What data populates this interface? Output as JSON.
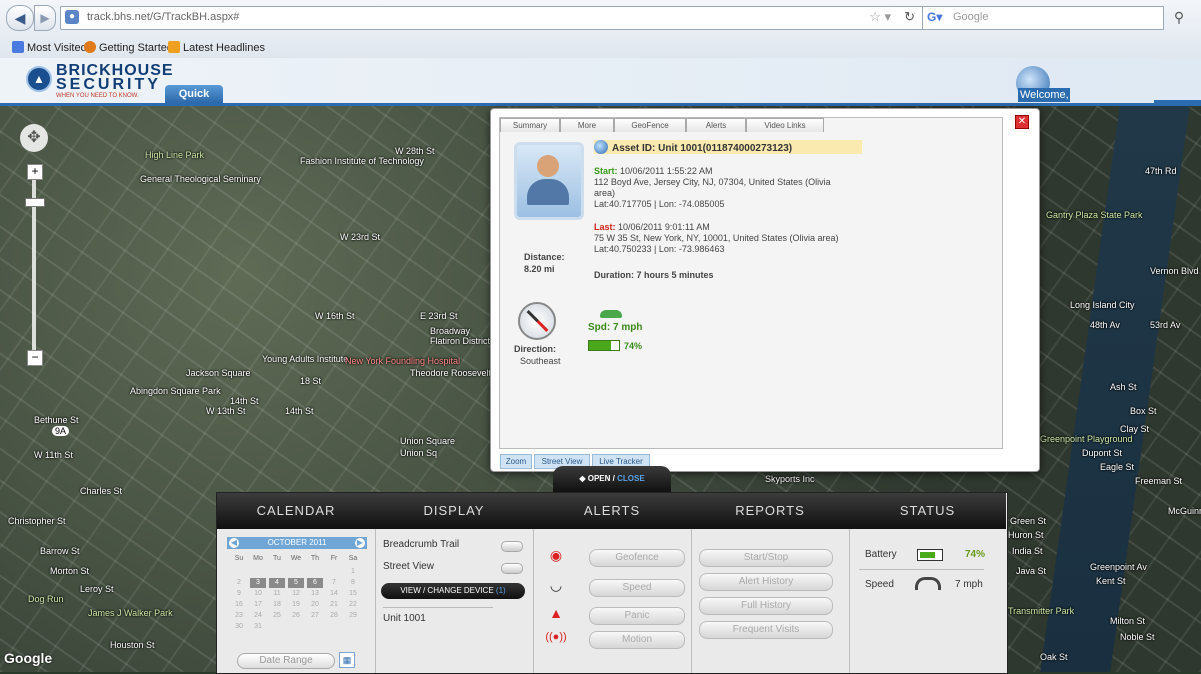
{
  "browser": {
    "back_icon": "back-arrow-icon",
    "url": "track.bhs.net/G/TrackBH.aspx#",
    "search_placeholder": "Google",
    "bookmarks": [
      "Most Visited",
      "Getting Started",
      "Latest Headlines"
    ]
  },
  "header": {
    "logo_line1": "BRICKHOUSE",
    "logo_line2": "SECURITY",
    "logo_tagline": "WHEN YOU NEED TO KNOW.",
    "quick_view_tab": "Quick View",
    "welcome": "Welcome,"
  },
  "map": {
    "labels": {
      "high_line": "High Line Park",
      "general_seminary": "General Theological Seminary",
      "fashion": "Fashion Institute of Technology",
      "w28": "W 28th St",
      "w23": "W 23rd St",
      "e23": "E 23rd St",
      "broadway": "Broadway",
      "flatiron": "Flatiron District",
      "young_adults": "Young Adults Institute",
      "ny_foundling": "New York Foundling Hospital",
      "theodore": "Theodore Roosevelt Birthplace",
      "jackson": "Jackson Square",
      "abingdon": "Abingdon Square Park",
      "bethune": "Bethune St",
      "union_sq": "Union Square",
      "w14": "14th St",
      "w11": "W 11th St",
      "charles": "Charles St",
      "christopher": "Christopher St",
      "barrow": "Barrow St",
      "morton": "Morton St",
      "leroy": "Leroy St",
      "dog_run": "Dog Run",
      "james_walker": "James J Walker Park",
      "houston": "Houston St",
      "skyports": "Skyports Inc",
      "gantry": "Gantry Plaza State Park",
      "vernon": "Vernon Blvd Jackson Av",
      "long_island": "Long Island City",
      "greenpoint": "Greenpoint Playground",
      "dupont": "Dupont St",
      "eagle": "Eagle St",
      "freeman": "Freeman St",
      "green_st": "Green St",
      "huron": "Huron St",
      "india": "India St",
      "java": "Java St",
      "greenpoint_av": "Greenpoint Av",
      "kent": "Kent St",
      "transmitter": "Transmitter Park",
      "milton": "Milton St",
      "noble": "Noble St",
      "oak": "Oak St",
      "route_9a": "9A",
      "w47": "47th Rd",
      "ave53": "53rd Av",
      "ave48": "48th Av",
      "box": "Box St",
      "clay": "Clay St",
      "ash": "Ash St",
      "mcguinness": "McGuinness Blvd",
      "w16": "W 16th St",
      "w18": "18 St",
      "w14b": "14th St",
      "union_sq2": "Union Sq",
      "w13": "W 13th St"
    },
    "google": "Google"
  },
  "popup": {
    "tabs": [
      "Summary",
      "More",
      "GeoFence",
      "Alerts",
      "Video Links"
    ],
    "asset_id": "Asset ID: Unit 1001(011874000273123)",
    "start_label": "Start:",
    "start_time": "10/06/2011 1:55:22 AM",
    "start_address": "112 Boyd Ave, Jersey City, NJ, 07304, United States (Olivia area)",
    "start_coords": "Lat:40.717705 | Lon: -74.085005",
    "last_label": "Last:",
    "last_time": "10/06/2011 9:01:11 AM",
    "last_address": "75 W 35 St, New York, NY, 10001, United States (Olivia area)",
    "last_coords": "Lat:40.750233 | Lon: -73.986463",
    "distance_label": "Distance:",
    "distance_value": "8.20 mi",
    "duration": "Duration: 7 hours 5 minutes",
    "direction_label": "Direction:",
    "direction_value": "Southeast",
    "speed": "Spd: 7 mph",
    "battery_pct": "74%",
    "battery_level": 0.74,
    "links": [
      "Zoom",
      "Street View",
      "Live Tracker"
    ]
  },
  "toggle": {
    "open": "OPEN /",
    "close": "CLOSE"
  },
  "panel": {
    "calendar": {
      "header": "CALENDAR",
      "month": "OCTOBER 2011",
      "dow": [
        "Su",
        "Mo",
        "Tu",
        "We",
        "Th",
        "Fr",
        "Sa"
      ],
      "weeks": [
        [
          "",
          "",
          "",
          "",
          "",
          "",
          "1"
        ],
        [
          "2",
          "3",
          "4",
          "5",
          "6",
          "7",
          "8"
        ],
        [
          "9",
          "10",
          "11",
          "12",
          "13",
          "14",
          "15"
        ],
        [
          "16",
          "17",
          "18",
          "19",
          "20",
          "21",
          "22"
        ],
        [
          "23",
          "24",
          "25",
          "26",
          "27",
          "28",
          "29"
        ],
        [
          "30",
          "31",
          "",
          "",
          "",
          "",
          ""
        ]
      ],
      "selected": [
        "3",
        "4",
        "5",
        "6"
      ],
      "date_range": "Date Range"
    },
    "display": {
      "header": "DISPLAY",
      "breadcrumb": "Breadcrumb Trail",
      "street_view": "Street View",
      "view_change": "VIEW / CHANGE DEVICE",
      "device_count": "(1)",
      "unit": "Unit 1001"
    },
    "alerts": {
      "header": "ALERTS",
      "items": [
        "Geofence",
        "Speed",
        "Panic",
        "Motion"
      ]
    },
    "reports": {
      "header": "REPORTS",
      "items": [
        "Start/Stop",
        "Alert History",
        "Full History",
        "Frequent Visits"
      ]
    },
    "status": {
      "header": "STATUS",
      "battery_label": "Battery",
      "battery_value": "74%",
      "battery_level": 0.74,
      "speed_label": "Speed",
      "speed_value": "7 mph"
    }
  },
  "colors": {
    "brand_blue": "#2b6cb0",
    "start_green": "#3a9a1a",
    "last_red": "#d42020",
    "asset_highlight": "#faeab0"
  }
}
